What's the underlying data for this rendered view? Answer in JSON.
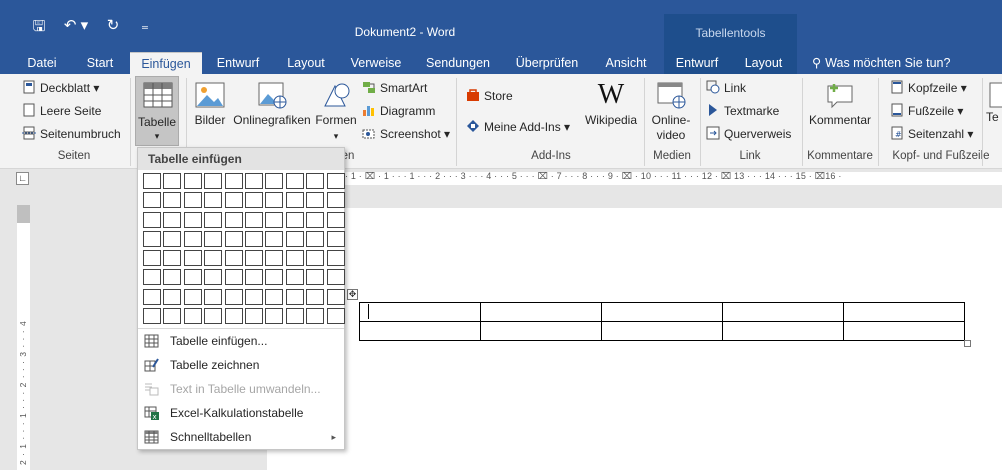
{
  "window": {
    "title": "Dokument2 - Word",
    "context_header": "Tabellentools"
  },
  "qat": {
    "save": "🖫",
    "undo": "↶ ▾",
    "redo": "↻",
    "customize": "₌"
  },
  "tabs": [
    {
      "label": "Datei"
    },
    {
      "label": "Start"
    },
    {
      "label": "Einfügen"
    },
    {
      "label": "Entwurf"
    },
    {
      "label": "Layout"
    },
    {
      "label": "Verweise"
    },
    {
      "label": "Sendungen"
    },
    {
      "label": "Überprüfen"
    },
    {
      "label": "Ansicht"
    },
    {
      "label": "Entwurf"
    },
    {
      "label": "Layout"
    }
  ],
  "tellme": {
    "label": "Was möchten Sie tun?"
  },
  "ribbon": {
    "seiten": {
      "label": "Seiten",
      "deckblatt": "Deckblatt ▾",
      "leere_seite": "Leere Seite",
      "seitenumbruch": "Seitenumbruch"
    },
    "tabellen": {
      "tabelle": "Tabelle",
      "caret": "▾"
    },
    "illustrationen": {
      "label": "en",
      "bilder": "Bilder",
      "onlinegrafiken": "Onlinegrafiken",
      "formen": "Formen",
      "formen_caret": "▾",
      "smartart": "SmartArt",
      "diagramm": "Diagramm",
      "screenshot": "Screenshot ▾"
    },
    "addins": {
      "label": "Add-Ins",
      "store": "Store",
      "meine_addins": "Meine Add-Ins ▾",
      "wikipedia": "Wikipedia"
    },
    "medien": {
      "label": "Medien",
      "online_video_1": "Online-",
      "online_video_2": "video"
    },
    "links": {
      "label": "Link",
      "link": "Link",
      "textmarke": "Textmarke",
      "querverweis": "Querverweis"
    },
    "kommentare": {
      "label": "Kommentare",
      "kommentar": "Kommentar"
    },
    "kopf_fuss": {
      "label": "Kopf- und Fußzeile",
      "kopfzeile": "Kopfzeile ▾",
      "fusszeile": "Fußzeile ▾",
      "seitenzahl": "Seitenzahl ▾"
    },
    "text": {
      "te": "Te"
    }
  },
  "ruler": {
    "corner": "∟",
    "horizontal": "· 1 · ⌧ · 1 · · · 1 · · · 2 · · · 3 · · · 4 · · · 5 · · · ⌧ · 7 · · · 8 · · · 9 · ⌧ · 10 · · · 11 · · · 12 · ⌧ 13 · · · 14 · · · 15 · ⌧16 ·",
    "vertical": "2 · 1 · · · 1 · · · 2 · · · 3 · · · 4"
  },
  "dropdown": {
    "header": "Tabelle einfügen",
    "items": [
      {
        "label": "Tabelle einfügen..."
      },
      {
        "label": "Tabelle zeichnen"
      },
      {
        "label": "Text in Tabelle umwandeln..."
      },
      {
        "label": "Excel-Kalkulationstabelle"
      },
      {
        "label": "Schnelltabellen",
        "arrow": "▸"
      }
    ]
  },
  "document": {
    "table_move_handle": "✥"
  },
  "colors": {
    "accent": "#2b579a",
    "context_tab": "#1e4e8c",
    "ribbon_bg": "#f3f3f3"
  }
}
